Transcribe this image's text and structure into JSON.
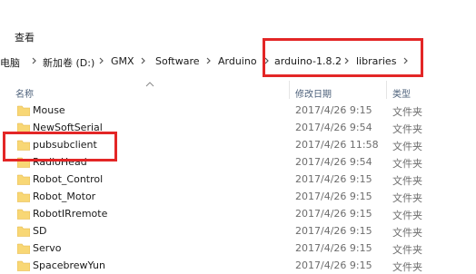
{
  "ribbon": {
    "view_tab": "查看"
  },
  "breadcrumb": {
    "items": [
      "电脑",
      "新加卷 (D:)",
      "GMX",
      "Software",
      "Arduino",
      "arduino-1.8.2",
      "libraries"
    ]
  },
  "columns": {
    "name": "名称",
    "modified": "修改日期",
    "type": "类型"
  },
  "files": [
    {
      "name": "Mouse",
      "date": "2017/4/26 9:15",
      "type": "文件夹"
    },
    {
      "name": "NewSoftSerial",
      "date": "2017/4/26 9:54",
      "type": "文件夹"
    },
    {
      "name": "pubsubclient",
      "date": "2017/4/26 11:58",
      "type": "文件夹"
    },
    {
      "name": "RadioHead",
      "date": "2017/4/26 9:54",
      "type": "文件夹"
    },
    {
      "name": "Robot_Control",
      "date": "2017/4/26 9:15",
      "type": "文件夹"
    },
    {
      "name": "Robot_Motor",
      "date": "2017/4/26 9:15",
      "type": "文件夹"
    },
    {
      "name": "RobotIRremote",
      "date": "2017/4/26 9:15",
      "type": "文件夹"
    },
    {
      "name": "SD",
      "date": "2017/4/26 9:15",
      "type": "文件夹"
    },
    {
      "name": "Servo",
      "date": "2017/4/26 9:15",
      "type": "文件夹"
    },
    {
      "name": "SpacebrewYun",
      "date": "2017/4/26 9:15",
      "type": "文件夹"
    }
  ],
  "colors": {
    "folder": "#f8d775",
    "folder_dark": "#e3b341",
    "highlight_box": "#e32626"
  },
  "icons": {
    "separator": "chevron-right-icon",
    "folder": "folder-icon",
    "sort": "sort-up-icon"
  }
}
